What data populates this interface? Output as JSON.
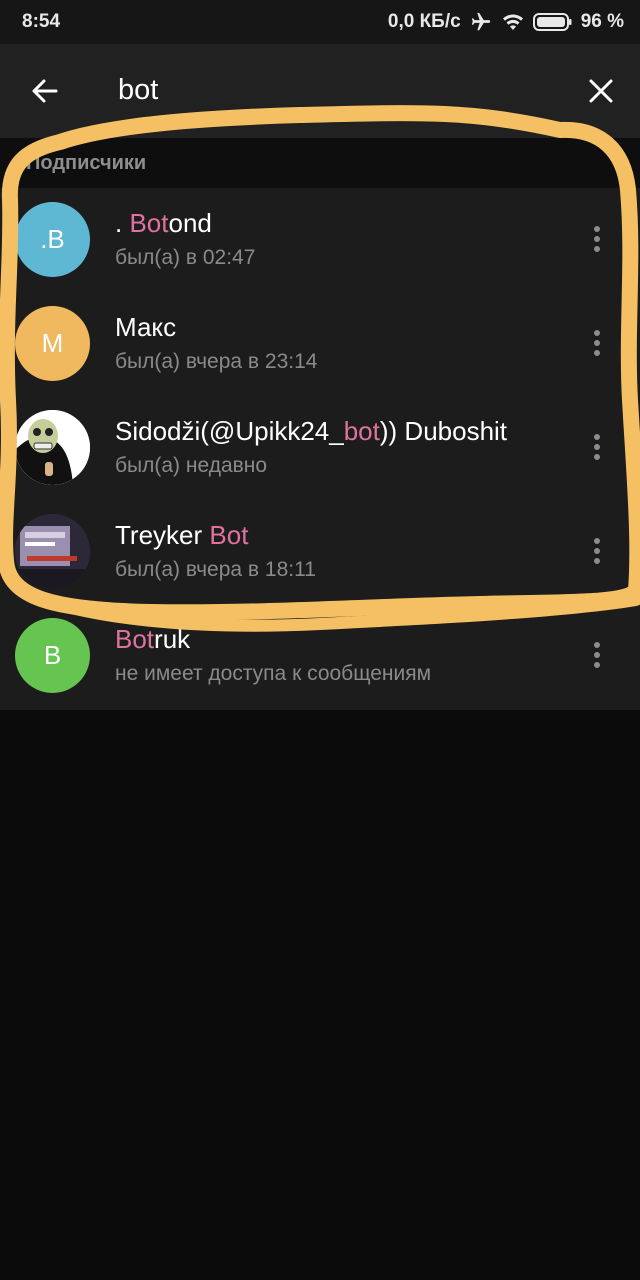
{
  "status_bar": {
    "time": "8:54",
    "network_speed": "0,0 КБ/с",
    "battery": "96 %",
    "icons": [
      "airplane-icon",
      "wifi-icon",
      "battery-icon"
    ]
  },
  "search": {
    "query": "bot",
    "back_icon": "arrow-left-icon",
    "clear_icon": "close-icon"
  },
  "section": {
    "title": "Подписчики"
  },
  "members": [
    {
      "name_prefix": ". ",
      "name_highlight": "Bot",
      "name_suffix": "ond",
      "status": "был(а) в 02:47",
      "avatar_letters": ".B",
      "avatar_color": "#5fb8d3"
    },
    {
      "name_prefix": "Макс",
      "name_highlight": "",
      "name_suffix": "",
      "status": "был(а) вчера в 23:14",
      "avatar_letters": "М",
      "avatar_color": "#f0b85f"
    },
    {
      "name_prefix": "Sidodži(@Upikk24_",
      "name_highlight": "bot",
      "name_suffix": ")) Duboshit",
      "status": "был(а) недавно",
      "avatar_letters": "",
      "avatar_color": "#ffffff"
    },
    {
      "name_prefix": "Treyker ",
      "name_highlight": "Bot",
      "name_suffix": "",
      "status": "был(а) вчера в 18:11",
      "avatar_letters": "",
      "avatar_color": "#3a3446"
    },
    {
      "name_prefix": "",
      "name_highlight": "Bot",
      "name_suffix": "ruk",
      "status": "не имеет доступа к сообщениям",
      "avatar_letters": "B",
      "avatar_color": "#66c551"
    }
  ],
  "colors": {
    "highlight": "#e0729f",
    "annotation_stroke": "#f5c063",
    "background": "#0b0b0b"
  }
}
